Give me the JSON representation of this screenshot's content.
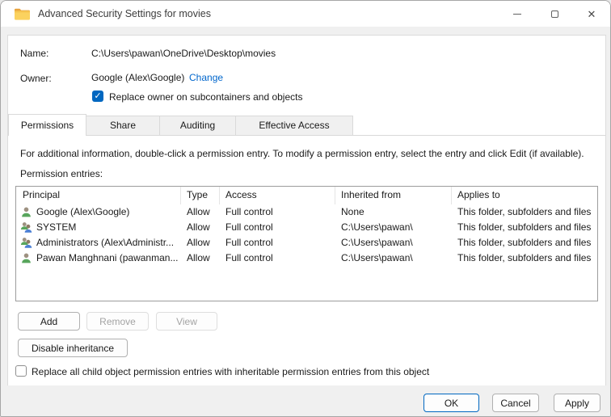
{
  "window": {
    "title": "Advanced Security Settings for movies",
    "controls": {
      "minimize": "minimize",
      "maximize": "maximize",
      "close": "close"
    }
  },
  "header": {
    "name_label": "Name:",
    "name_value": "C:\\Users\\pawan\\OneDrive\\Desktop\\movies",
    "owner_label": "Owner:",
    "owner_value": "Google (Alex\\Google)",
    "change_link": "Change",
    "replace_owner_label": "Replace owner on subcontainers and objects",
    "replace_owner_checked": true,
    "check_glyph": "✓"
  },
  "tabs": [
    {
      "label": "Permissions",
      "active": true
    },
    {
      "label": "Share",
      "active": false
    },
    {
      "label": "Auditing",
      "active": false
    },
    {
      "label": "Effective Access",
      "active": false
    }
  ],
  "permissions": {
    "description": "For additional information, double-click a permission entry. To modify a permission entry, select the entry and click Edit (if available).",
    "entries_label": "Permission entries:",
    "table": {
      "columns": [
        "Principal",
        "Type",
        "Access",
        "Inherited from",
        "Applies to"
      ],
      "rows": [
        {
          "icon": "user-icon",
          "principal": "Google (Alex\\Google)",
          "type": "Allow",
          "access": "Full control",
          "inherited_from": "None",
          "applies_to": "This folder, subfolders and files"
        },
        {
          "icon": "group-icon",
          "principal": "SYSTEM",
          "type": "Allow",
          "access": "Full control",
          "inherited_from": "C:\\Users\\pawan\\",
          "applies_to": "This folder, subfolders and files"
        },
        {
          "icon": "group-icon",
          "principal": "Administrators (Alex\\Administr...",
          "type": "Allow",
          "access": "Full control",
          "inherited_from": "C:\\Users\\pawan\\",
          "applies_to": "This folder, subfolders and files"
        },
        {
          "icon": "user-icon",
          "principal": "Pawan Manghnani (pawanman...",
          "type": "Allow",
          "access": "Full control",
          "inherited_from": "C:\\Users\\pawan\\",
          "applies_to": "This folder, subfolders and files"
        }
      ]
    },
    "buttons": {
      "add": "Add",
      "remove": "Remove",
      "remove_enabled": false,
      "view": "View",
      "view_enabled": false,
      "disable_inheritance": "Disable inheritance"
    },
    "replace_child_label": "Replace all child object permission entries with inheritable permission entries from this object",
    "replace_child_checked": false
  },
  "footer": {
    "ok": "OK",
    "cancel": "Cancel",
    "apply": "Apply"
  },
  "colors": {
    "accent": "#0067c0",
    "link": "#0066cc",
    "footer_bg": "#f0f0f0"
  }
}
